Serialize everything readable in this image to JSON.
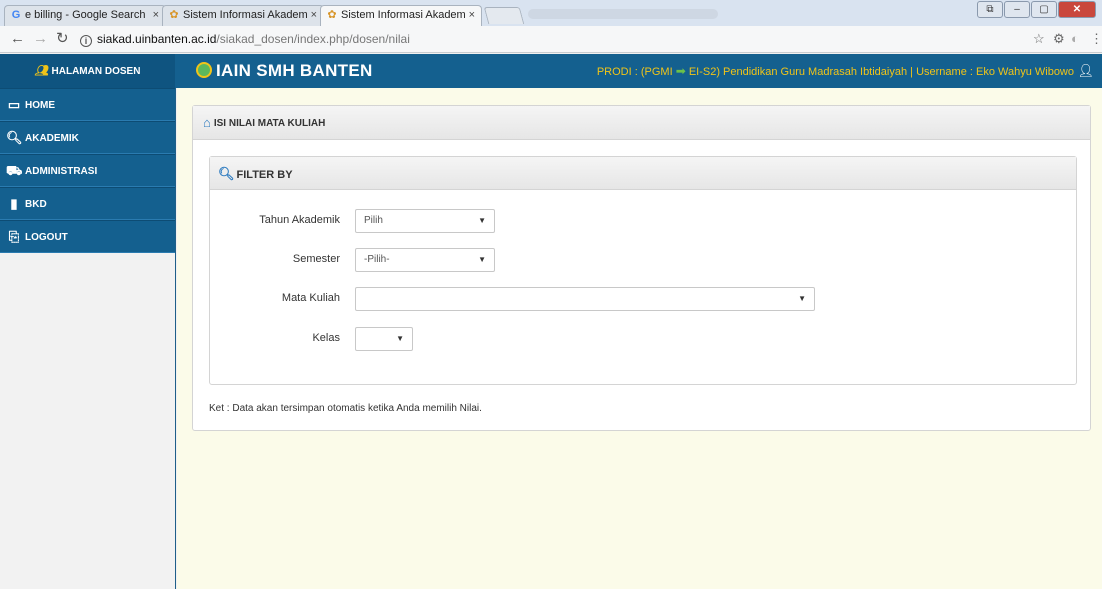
{
  "browser": {
    "tabs": [
      {
        "title": "e billing - Google Search",
        "favicon": "google-g-icon",
        "close": "×"
      },
      {
        "title": "Sistem Informasi Akadem",
        "favicon": "app-favicon-icon",
        "close": "×"
      },
      {
        "title": "Sistem Informasi Akadem",
        "favicon": "app-favicon-icon",
        "close": "×"
      }
    ],
    "url_host": "siakad.uinbanten.ac.id",
    "url_path": "/siakad_dosen/index.php/dosen/nilai",
    "info_glyph": "i"
  },
  "header": {
    "brand_label": "HALAMAN DOSEN",
    "logo_text": "IAIN SMH BANTEN",
    "prodi_prefix": "PRODI : (PGMI",
    "prodi_suffix": "EI-S2) Pendidikan Guru Madrasah Ibtidaiyah | Username : Eko Wahyu Wibowo"
  },
  "sidebar": {
    "items": [
      {
        "label": "HOME",
        "icon": "monitor-icon"
      },
      {
        "label": "AKADEMIK",
        "icon": "search-icon"
      },
      {
        "label": "ADMINISTRASI",
        "icon": "people-icon"
      },
      {
        "label": "BKD",
        "icon": "book-icon"
      },
      {
        "label": "LOGOUT",
        "icon": "logout-icon"
      }
    ]
  },
  "main": {
    "panel_title": "ISI NILAI MATA KULIAH",
    "filter_title": "FILTER BY",
    "fields": {
      "tahun_label": "Tahun Akademik",
      "tahun_value": "Pilih",
      "semester_label": "Semester",
      "semester_value": "-Pilih-",
      "matakuliah_label": "Mata Kuliah",
      "matakuliah_value": "",
      "kelas_label": "Kelas",
      "kelas_value": ""
    },
    "note": "Ket : Data akan tersimpan otomatis ketika Anda memilih Nilai."
  },
  "colors": {
    "header_bg": "#14608f",
    "sidebar_item_bg": "#14608f",
    "prodi_text": "#f0c419",
    "main_bg": "#fbfbe9"
  }
}
